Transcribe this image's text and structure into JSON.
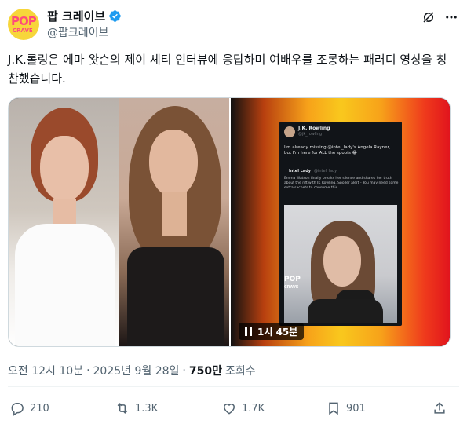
{
  "account": {
    "display_name": "팝 크레이브",
    "handle": "@팝크레이브",
    "avatar_text_top": "POP",
    "avatar_text_bottom": "CRAVE",
    "verified_color": "#1d9bf0"
  },
  "tweet": {
    "text": "J.K.롤링은 에마 왓슨의 제이 셰티 인터뷰에 응답하며 여배우를 조롱하는 패러디 영상을 칭찬했습니다."
  },
  "embedded_tweet": {
    "name": "J.K. Rowling",
    "handle": "@jk_rowling",
    "text": "I'm already missing @intel_lady's Angela Rayner, but I'm here for ALL the spoofs 😂",
    "quote_name": "Intel Lady",
    "quote_handle": "@intel_lady",
    "quote_text": "Emma Watson finally breaks her silence and shares her truth about the rift with JK Rowling. Spoiler alert - You may need some extra sachets to consume this.",
    "logo_text_top": "POP",
    "logo_text_bottom": "CRAVE"
  },
  "video": {
    "duration": "1시 45분"
  },
  "meta": {
    "time": "오전 12시 10분",
    "separator": "·",
    "date": "2025년 9월 28일",
    "views_count": "750만",
    "views_label": "조회수"
  },
  "actions": {
    "replies": "210",
    "reposts": "1.3K",
    "likes": "1.7K",
    "bookmarks": "901"
  },
  "colors": {
    "text_primary": "#0f1419",
    "text_secondary": "#536471",
    "verified": "#1d9bf0"
  },
  "icons": [
    "verified-badge-icon",
    "grok-icon",
    "more-icon",
    "pause-icon",
    "reply-icon",
    "repost-icon",
    "like-icon",
    "bookmark-icon",
    "share-icon"
  ]
}
